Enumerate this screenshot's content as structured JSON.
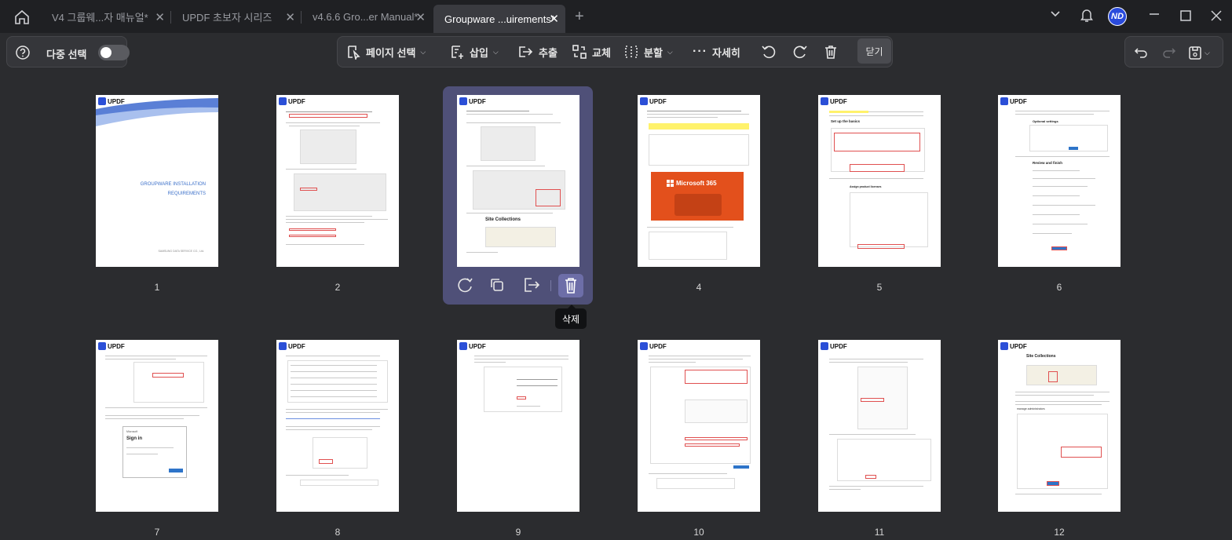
{
  "tabs": [
    {
      "label": "V4 그룹웨...자 매뉴얼*"
    },
    {
      "label": "UPDF 초보자 시리즈"
    },
    {
      "label": "v4.6.6 Gro...er Manual*"
    },
    {
      "label": "Groupware ...uirements*"
    }
  ],
  "user": {
    "initials": "ND"
  },
  "toolbar": {
    "multi_select": "다중 선택",
    "page_select": "페이지 선택",
    "insert": "삽입",
    "extract": "추출",
    "replace": "교체",
    "split": "분할",
    "more": "자세히",
    "close": "닫기"
  },
  "tooltip": {
    "delete": "삭제"
  },
  "logo_text": "UPDF",
  "page1": {
    "title_line1": "GROUPWARE INSTALLATION",
    "title_line2": "REQUIREMENTS",
    "company": "SAMSUNG DATA SERVICE CO., Ltd."
  },
  "page3": {
    "heading": "Site Collections"
  },
  "page4": {
    "banner": "Microsoft 365"
  },
  "page5": {
    "heading": "Set up the basics",
    "heading2": "Assign product licenses"
  },
  "page6": {
    "heading": "Optional settings",
    "heading2": "Review and finish"
  },
  "page7": {
    "signin": "Sign in",
    "ms": "Microsoft"
  },
  "page12": {
    "heading": "Site Collections",
    "sub": "manage administrators"
  },
  "pages": [
    {
      "num": "1"
    },
    {
      "num": "2"
    },
    {
      "num": "3"
    },
    {
      "num": "4"
    },
    {
      "num": "5"
    },
    {
      "num": "6"
    },
    {
      "num": "7"
    },
    {
      "num": "8"
    },
    {
      "num": "9"
    },
    {
      "num": "10"
    },
    {
      "num": "11"
    },
    {
      "num": "12"
    }
  ],
  "colors": {
    "accent": "#4f5078",
    "brand": "#2b4fd7",
    "ms_orange": "#e3501c"
  }
}
